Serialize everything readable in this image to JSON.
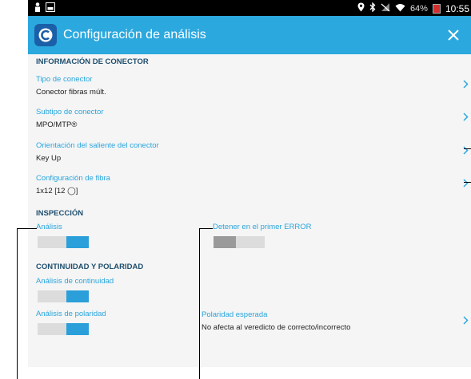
{
  "status_bar": {
    "battery": "64%",
    "time": "10:55"
  },
  "header": {
    "title": "Configuración de análisis"
  },
  "connector": {
    "heading": "INFORMACIÓN DE CONECTOR",
    "type_label": "Tipo de conector",
    "type_value": "Conector fibras múlt.",
    "subtype_label": "Subtipo de conector",
    "subtype_value": "MPO/MTP®",
    "orientation_label": "Orientación del saliente del conector",
    "orientation_value": "Key Up",
    "fiber_label": "Configuración de fibra",
    "fiber_value": "1x12 [12 ◯]"
  },
  "inspection": {
    "heading": "INSPECCIÓN",
    "analysis_label": "Análisis",
    "analysis_on": true,
    "stop_label": "Detener en el primer ERROR",
    "stop_on": false
  },
  "continuity": {
    "heading": "CONTINUIDAD Y POLARIDAD",
    "continuity_label": "Análisis de continuidad",
    "continuity_on": true,
    "polarity_label": "Análisis de polaridad",
    "polarity_on": true,
    "expected_label": "Polaridad esperada",
    "expected_value": "No afecta al veredicto de correcto/incorrecto"
  },
  "colors": {
    "accent": "#2ba8de",
    "toggle_on": "#2b9fd9",
    "heading": "#1f4f6e"
  }
}
